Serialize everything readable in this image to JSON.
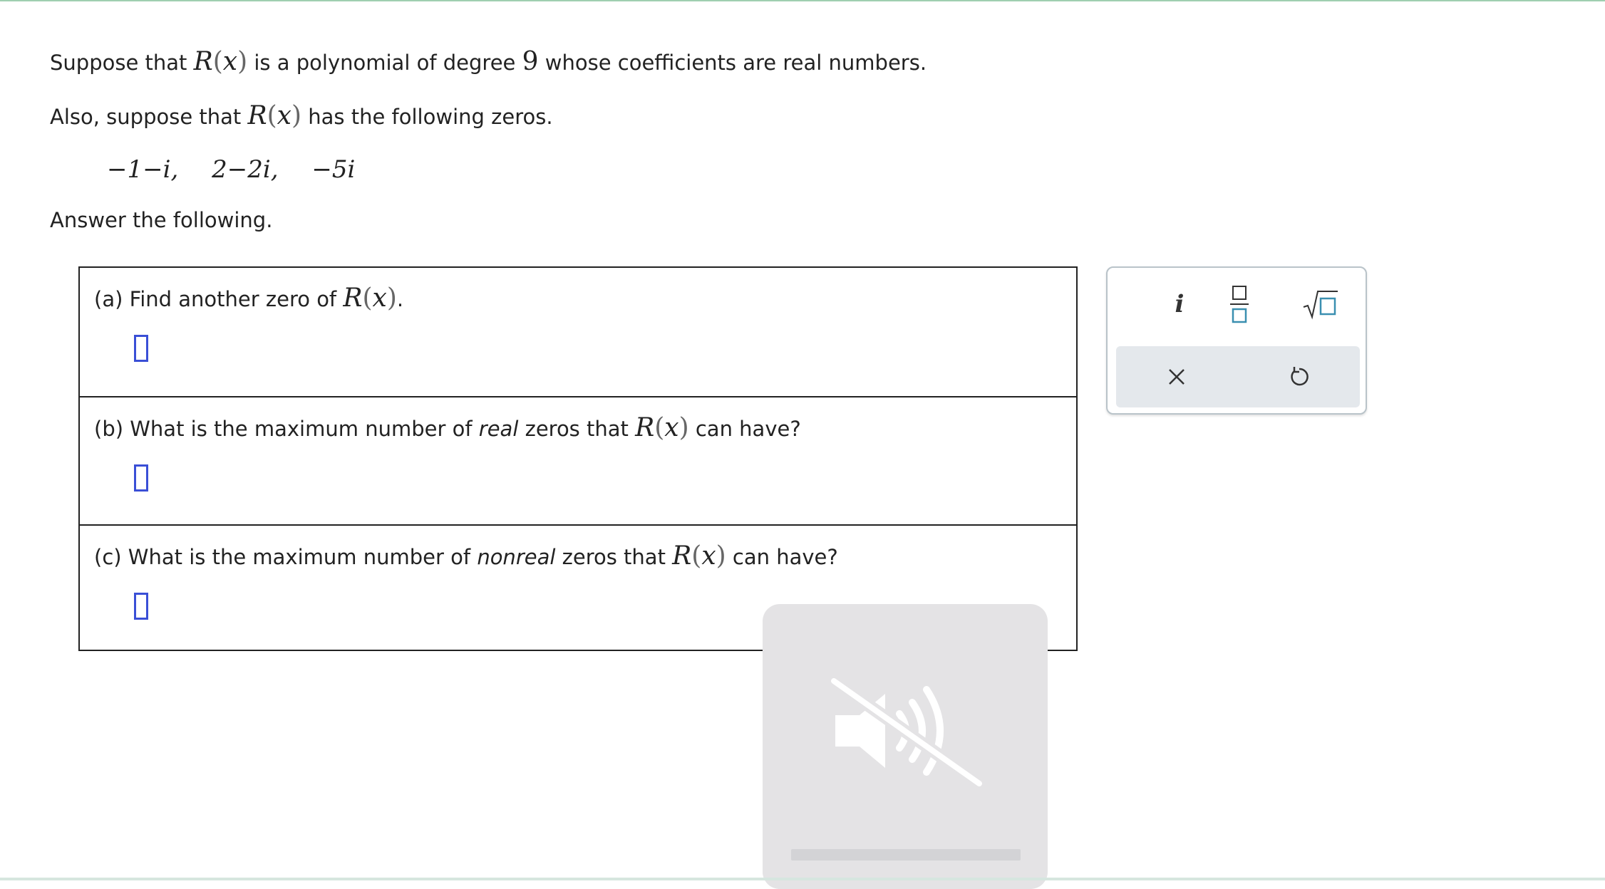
{
  "problem": {
    "line1_pre": "Suppose that ",
    "line1_fn": "R",
    "line1_arg": "x",
    "line1_mid": " is a polynomial of degree ",
    "line1_degree": "9",
    "line1_post": " whose coefficients are real numbers.",
    "line2_pre": "Also, suppose that ",
    "line2_fn": "R",
    "line2_arg": "x",
    "line2_post": " has the following zeros.",
    "zeros": [
      "−1−i,",
      "2−2i,",
      "−5i"
    ],
    "instruction": "Answer the following."
  },
  "questions": [
    {
      "pre": "(a) Find another zero of ",
      "emph": "",
      "post": "",
      "fn": "R",
      "arg": "x",
      "end": "."
    },
    {
      "pre": "(b) What is the maximum number of ",
      "emph": "real",
      "post": " zeros that ",
      "fn": "R",
      "arg": "x",
      "end": " can have?"
    },
    {
      "pre": "(c) What is the maximum number of ",
      "emph": "nonreal",
      "post": " zeros that ",
      "fn": "R",
      "arg": "x",
      "end": " can have?"
    }
  ],
  "palette": {
    "imaginary_label": "i",
    "fraction_icon": "fraction-icon",
    "sqrt_icon": "sqrt-icon",
    "clear_icon": "close-icon",
    "undo_icon": "undo-icon",
    "accent_color": "#3a8fb0"
  },
  "overlay": {
    "icon": "muted-speaker-icon"
  }
}
